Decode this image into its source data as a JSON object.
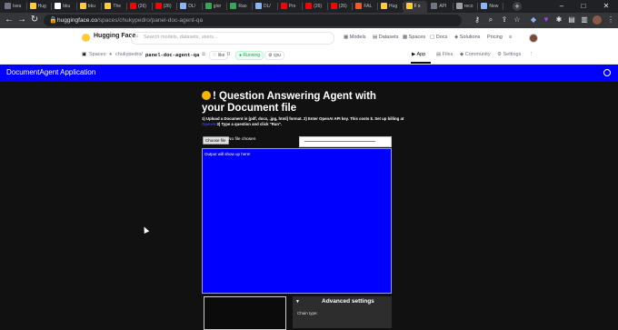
{
  "browser": {
    "tabs": [
      {
        "label": "Iseu",
        "color": "#6e7681"
      },
      {
        "label": "Hug",
        "color": "#ffcc33"
      },
      {
        "label": "bku",
        "color": "#ffffff"
      },
      {
        "label": "bku",
        "color": "#ffcc33"
      },
      {
        "label": "The",
        "color": "#ffcc33"
      },
      {
        "label": "(26)",
        "color": "#ff0000"
      },
      {
        "label": "(26)",
        "color": "#ff0000"
      },
      {
        "label": "DL/",
        "color": "#8ab4f8"
      },
      {
        "label": "glor",
        "color": "#34a853"
      },
      {
        "label": "Rao",
        "color": "#34a853"
      },
      {
        "label": "DL/",
        "color": "#8ab4f8"
      },
      {
        "label": "Pro",
        "color": "#ff0000"
      },
      {
        "label": "(26)",
        "color": "#ff0000"
      },
      {
        "label": "(26)",
        "color": "#ff0000"
      },
      {
        "label": "FAL",
        "color": "#ff5722"
      },
      {
        "label": "Hug",
        "color": "#ffcc33"
      },
      {
        "label": "F x",
        "color": "#ffcc33",
        "active": true
      },
      {
        "label": "API",
        "color": "#6e7681"
      },
      {
        "label": "reco",
        "color": "#9aa0a6"
      },
      {
        "label": "New",
        "color": "#8ab4f8"
      }
    ],
    "url_host": "huggingface.co",
    "url_path": "/spaces/chukypedro/panel-doc-agent-qa"
  },
  "hf": {
    "brand": "Hugging Face",
    "search_placeholder": "Search models, datasets, users...",
    "nav": [
      "Models",
      "Datasets",
      "Spaces",
      "Docs",
      "Solutions",
      "Pricing"
    ]
  },
  "space": {
    "crumb_label": "Spaces:",
    "owner": "chukypedro/",
    "name": "panel-doc-agent-qa",
    "like": "like",
    "like_count": "0",
    "status": "Running",
    "hardware": "cpu",
    "tabs": [
      "App",
      "Files",
      "Community",
      "Settings"
    ]
  },
  "app": {
    "title": "DocumentAgent Application",
    "heading": "! Question Answering Agent with your Document file",
    "instructions": "1) Upload a Document in [pdf, docx, .jpg, html] format. 2) Enter OpenAI API key. This costs $. Set up billing at",
    "instructions_link": "OpenAI",
    "instructions_tail": "3) Type a question and click \"Run\".",
    "file_button": "Choose file",
    "file_label": "No file chosen",
    "output_placeholder": "Output will show up here!",
    "advanced_title": "Advanced settings",
    "chain_type_label": "Chain type:"
  }
}
